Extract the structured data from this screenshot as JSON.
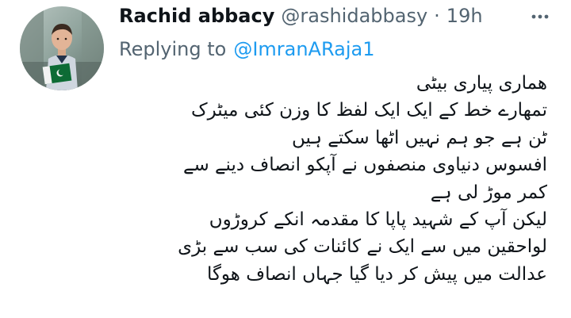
{
  "tweet": {
    "display_name": "Rachid abbacy",
    "handle": "@rashidabbasy",
    "separator": "·",
    "time": "19h",
    "more_icon": "ellipsis-icon",
    "replying_to_label": "Replying to",
    "replying_to_handle": "@ImranARaja1",
    "lines": [
      "ھماری پیاری بیٹی",
      "تمھارے خط کے ایک ایک  لفظ کا وزن کئی میٹرک",
      "ٹن ہے جو ہم نہیں اٹھا سکتے ہیں",
      "افسوس دنیاوی منصفوں نے آپکو انصاف دینے سے",
      "کمر موڑ لی ہے",
      "لیکن آپ کے شہید پاپا کا مقدمہ انکے کروڑوں",
      "لواحقین میں سے ایک  نے کائنات کی سب سے بڑی",
      "عدالت میں پیش کر دیا گیا  جہاں انصاف ھوگا"
    ]
  },
  "colors": {
    "text_primary": "#0f1419",
    "text_secondary": "#536471",
    "link": "#1d9bf0",
    "background": "#ffffff"
  }
}
